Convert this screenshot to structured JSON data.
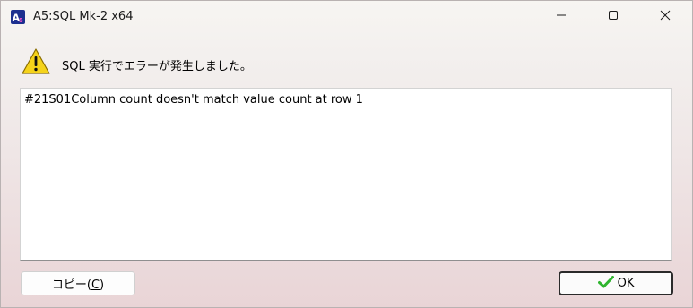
{
  "window": {
    "title": "A5:SQL Mk-2 x64"
  },
  "title_controls": {
    "minimize_icon": "minimize-icon",
    "maximize_icon": "maximize-icon",
    "close_icon": "close-icon"
  },
  "message": {
    "icon": "warning-icon",
    "text": "SQL 実行でエラーが発生しました。"
  },
  "detail": {
    "text": "#21S01Column count doesn't match value count at row 1"
  },
  "buttons": {
    "copy_prefix": "コピー(",
    "copy_mnemonic": "C",
    "copy_suffix": ")",
    "ok_icon": "checkmark-icon",
    "ok_label": "OK"
  },
  "colors": {
    "ok_check": "#2fb52f",
    "warning_fill": "#f5d31a"
  }
}
